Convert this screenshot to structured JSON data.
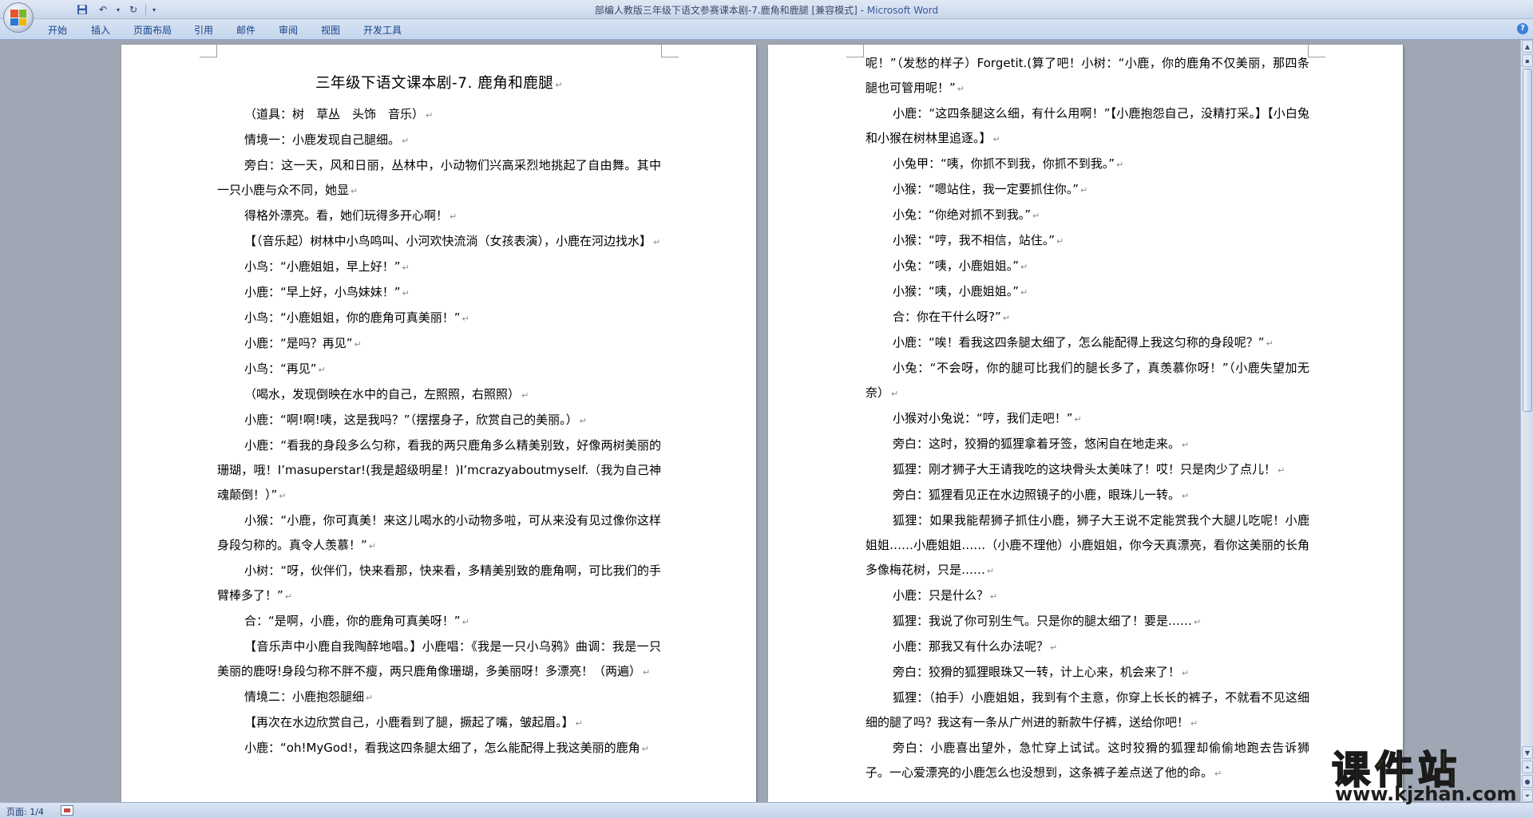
{
  "window": {
    "title": "部编人教版三年级下语文参赛课本剧-7.鹿角和鹿腿 [兼容模式] - ",
    "app_name": "Microsoft Word"
  },
  "quick_access": {
    "icons": [
      "save-icon",
      "undo-icon",
      "redo-icon",
      "customize-icon"
    ],
    "undo_glyph": "↶",
    "redo_glyph": "↻",
    "more_glyph": "▾"
  },
  "ribbon": {
    "tabs": [
      {
        "label": "开始"
      },
      {
        "label": "插入"
      },
      {
        "label": "页面布局"
      },
      {
        "label": "引用"
      },
      {
        "label": "邮件"
      },
      {
        "label": "审阅"
      },
      {
        "label": "视图"
      },
      {
        "label": "开发工具"
      }
    ],
    "help_glyph": "?"
  },
  "document": {
    "title": "三年级下语文课本剧-7. 鹿角和鹿腿",
    "page_left": [
      "（道具：树　草丛　头饰　音乐）",
      "情境一：小鹿发现自己腿细。",
      "旁白：这一天，风和日丽，丛林中，小动物们兴高采烈地挑起了自由舞。其中一只小鹿与众不同，她显",
      "得格外漂亮。看，她们玩得多开心啊！",
      "【（音乐起）树林中小鸟鸣叫、小河欢快流淌（女孩表演），小鹿在河边找水】",
      "小鸟：“小鹿姐姐，早上好！”",
      "小鹿：“早上好，小鸟妹妹！”",
      "小鸟：“小鹿姐姐，你的鹿角可真美丽！”",
      "小鹿：“是吗？再见”",
      "小鸟：“再见”",
      "（喝水，发现倒映在水中的自己，左照照，右照照）",
      "小鹿：“啊!啊!咦，这是我吗？”（摆摆身子，欣赏自己的美丽。）",
      "小鹿：“看我的身段多么匀称，看我的两只鹿角多么精美别致，好像两树美丽的珊瑚，哦！I’masuperstar!(我是超级明星！)I’mcrazyaboutmyself.（我为自己神魂颠倒！）”",
      "小猴：“小鹿，你可真美！来这儿喝水的小动物多啦，可从来没有见过像你这样身段匀称的。真令人羡慕！”",
      "小树：“呀，伙伴们，快来看那，快来看，多精美别致的鹿角啊，可比我们的手臂棒多了！”",
      "合：“是啊，小鹿，你的鹿角可真美呀！”",
      "【音乐声中小鹿自我陶醉地唱。】小鹿唱：《我是一只小乌鸦》曲调：我是一只美丽的鹿呀!身段匀称不胖不瘦，两只鹿角像珊瑚，多美丽呀！多漂亮！（两遍）",
      "情境二：小鹿抱怨腿细",
      "【再次在水边欣赏自己，小鹿看到了腿，撅起了嘴，皱起眉。】",
      "小鹿：“oh!MyGod!，看我这四条腿太细了，怎么能配得上我这美丽的鹿角"
    ],
    "page_right": [
      "呢！”（发愁的样子）Forgetit.(算了吧！小树：“小鹿，你的鹿角不仅美丽，那四条腿也可管用呢！”",
      "小鹿：“这四条腿这么细，有什么用啊！”【小鹿抱怨自己，没精打采。】【小白兔和小猴在树林里追逐。】",
      "小兔甲：“咦，你抓不到我，你抓不到我。”",
      "小猴：“嗯站住，我一定要抓住你。”",
      "小兔：“你绝对抓不到我。”",
      "小猴：“哼，我不相信，站住。”",
      "小兔：“咦，小鹿姐姐。”",
      "小猴：“咦，小鹿姐姐。”",
      "合：你在干什么呀?”",
      "小鹿：“唉！看我这四条腿太细了，怎么能配得上我这匀称的身段呢？”",
      "小兔：“不会呀，你的腿可比我们的腿长多了，真羡慕你呀！”（小鹿失望加无奈）",
      "小猴对小兔说：“哼，我们走吧！”",
      "旁白：这时，狡猾的狐狸拿着牙签，悠闲自在地走来。",
      "狐狸：刚才狮子大王请我吃的这块骨头太美味了！哎！只是肉少了点儿！",
      "旁白：狐狸看见正在水边照镜子的小鹿，眼珠儿一转。",
      "狐狸：如果我能帮狮子抓住小鹿，狮子大王说不定能赏我个大腿儿吃呢！小鹿姐姐……小鹿姐姐……（小鹿不理他）小鹿姐姐，你今天真漂亮，看你这美丽的长角多像梅花树，只是……",
      "小鹿：只是什么？",
      "狐狸：我说了你可别生气。只是你的腿太细了！要是……",
      "小鹿：那我又有什么办法呢？",
      "旁白：狡猾的狐狸眼珠又一转，计上心来，机会来了！",
      "狐狸：（拍手）小鹿姐姐，我到有个主意，你穿上长长的裤子，不就看不见这细细的腿了吗？我这有一条从广州进的新款牛仔裤，送给你吧！",
      "旁白：小鹿喜出望外，急忙穿上试试。这时狡猾的狐狸却偷偷地跑去告诉狮子。一心爱漂亮的小鹿怎么也没想到，这条裤子差点送了他的命。"
    ]
  },
  "status_bar": {
    "page_indicator": "页面: 1/4"
  },
  "watermark": {
    "title": "课件站",
    "url": "www.kjzhan.com"
  },
  "colors": {
    "workspace": "#9fa7b5",
    "ribbon_text": "#15428b",
    "watermark_yellow": "#f6e600"
  }
}
